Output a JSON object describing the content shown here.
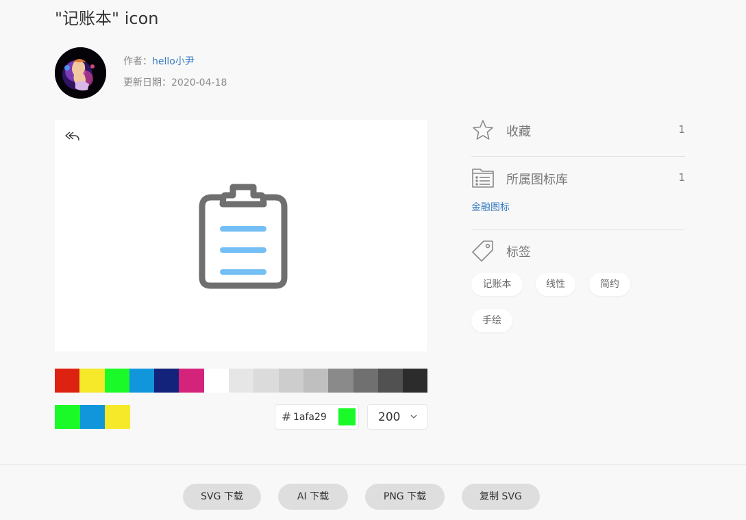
{
  "page": {
    "title": "\"记账本\" icon"
  },
  "author": {
    "label": "作者：",
    "name": "hello小尹",
    "date_label": "更新日期：",
    "date": "2020-04-18"
  },
  "preview": {
    "back_icon": "undo-icon",
    "icon_name": "clipboard-icon"
  },
  "palette": {
    "colors": [
      "#dd2211",
      "#f5e92a",
      "#1afa29",
      "#1296db",
      "#13227a",
      "#d4237a",
      "#ffffff",
      "#e6e6e6",
      "#dbdbdb",
      "#cdcdcd",
      "#bfbfbf",
      "#8a8a8a",
      "#707070",
      "#515151",
      "#2c2c2c"
    ],
    "recent": [
      "#1afa29",
      "#1296db",
      "#f5e92a"
    ]
  },
  "color_input": {
    "hash": "#",
    "value": "1afa29",
    "swatch": "#1afa29"
  },
  "size_select": {
    "value": "200"
  },
  "sidebar": {
    "favorite": {
      "label": "收藏",
      "count": "1",
      "icon": "star-icon"
    },
    "library": {
      "label": "所属图标库",
      "count": "1",
      "icon": "folder-list-icon",
      "link": "金融图标"
    },
    "tags": {
      "label": "标签",
      "icon": "tag-icon",
      "items": [
        "记账本",
        "线性",
        "简约",
        "手绘"
      ]
    }
  },
  "downloads": [
    "SVG 下载",
    "AI 下载",
    "PNG 下载",
    "复制 SVG"
  ]
}
